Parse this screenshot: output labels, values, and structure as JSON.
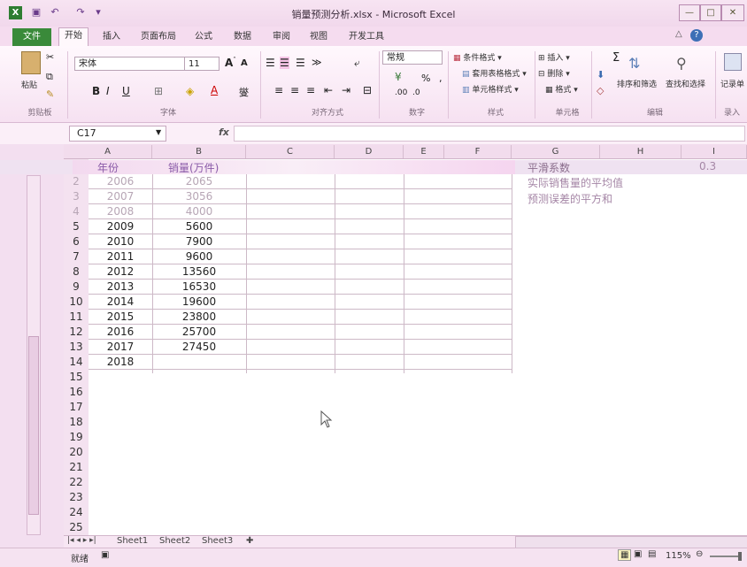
{
  "window": {
    "title": "销量预测分析.xlsx - Microsoft Excel",
    "controls": [
      "—",
      "□",
      "✕"
    ]
  },
  "ribbon": {
    "tabs": [
      "文件",
      "开始",
      "插入",
      "页面布局",
      "公式",
      "数据",
      "审阅",
      "视图",
      "开发工具"
    ],
    "groups": {
      "clipboard": "剪贴板",
      "font": "字体",
      "alignment": "对齐方式",
      "number": "数字",
      "styles": "样式",
      "cells": "单元格",
      "editing": "编辑",
      "record": "录入"
    },
    "paste_label": "粘贴",
    "font_name": "宋体",
    "font_size": "11",
    "number_format": "常规",
    "conditional_format": "条件格式",
    "table_format": "套用表格格式",
    "cell_styles": "单元格样式",
    "insert": "插入",
    "delete": "删除",
    "format": "格式",
    "sort_filter": "排序和筛选",
    "find_select": "查找和选择",
    "record_sheet": "记录单",
    "percent": "%",
    "comma": ","
  },
  "formula_bar": {
    "name_box": "C17",
    "fx": "fx",
    "content": ""
  },
  "columns": [
    "A",
    "B",
    "C",
    "D",
    "E",
    "F",
    "G",
    "H",
    "I"
  ],
  "header_row": {
    "a": "年份",
    "b": "销量(万件)"
  },
  "rows": [
    {
      "num": "2",
      "year": "2006",
      "value": "2065",
      "faint": true
    },
    {
      "num": "3",
      "year": "2007",
      "value": "3056",
      "faint": true
    },
    {
      "num": "4",
      "year": "2008",
      "value": "4000",
      "faint": true
    },
    {
      "num": "5",
      "year": "2009",
      "value": "5600"
    },
    {
      "num": "6",
      "year": "2010",
      "value": "7900"
    },
    {
      "num": "7",
      "year": "2011",
      "value": "9600"
    },
    {
      "num": "8",
      "year": "2012",
      "value": "13560"
    },
    {
      "num": "9",
      "year": "2013",
      "value": "16530"
    },
    {
      "num": "10",
      "year": "2014",
      "value": "19600"
    },
    {
      "num": "11",
      "year": "2015",
      "value": "23800"
    },
    {
      "num": "12",
      "year": "2016",
      "value": "25700"
    },
    {
      "num": "13",
      "year": "2017",
      "value": "27450"
    },
    {
      "num": "14",
      "year": "2018",
      "value": ""
    }
  ],
  "empty_rows": [
    "15",
    "16",
    "17",
    "18",
    "19",
    "20",
    "21",
    "22",
    "23",
    "24",
    "25"
  ],
  "side_notes": {
    "title": "平滑系数",
    "value": "0.3",
    "line1": "实际销售量的平均值",
    "line2": "预测误差的平方和"
  },
  "sheets": [
    "Sheet1",
    "Sheet2",
    "Sheet3"
  ],
  "status": {
    "ready": "就绪",
    "zoom": "115%"
  },
  "colors": {
    "file_tab": "#3a8a3a",
    "background_tint": "#f3dff0"
  }
}
